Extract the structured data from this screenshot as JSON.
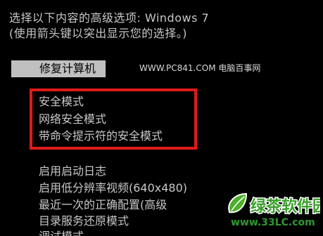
{
  "header": {
    "line1": "选择以下内容的高级选项: Windows 7",
    "line2": "(使用箭头键以突出显示您的选择。)"
  },
  "selected_item": "修复计算机",
  "watermark_site": "WWW.PC841.COM 电脑百事网",
  "menu": {
    "safe_modes": [
      "安全模式",
      "网络安全模式",
      "带命令提示符的安全模式"
    ],
    "other_options": [
      "启用启动日志",
      "启用低分辨率视频(640x480)",
      "最近一次的正确配置(高级",
      "目录服务还原模式",
      "调试模式"
    ]
  },
  "watermark_brand": {
    "logo_text": "绿茶软件园",
    "url": "www.33LC.com"
  },
  "colors": {
    "background": "#000000",
    "text": "#c8c8c8",
    "selected_bg": "#c0c0c0",
    "highlight_border": "#e01a1a",
    "brand_green": "#2e9a2e"
  }
}
